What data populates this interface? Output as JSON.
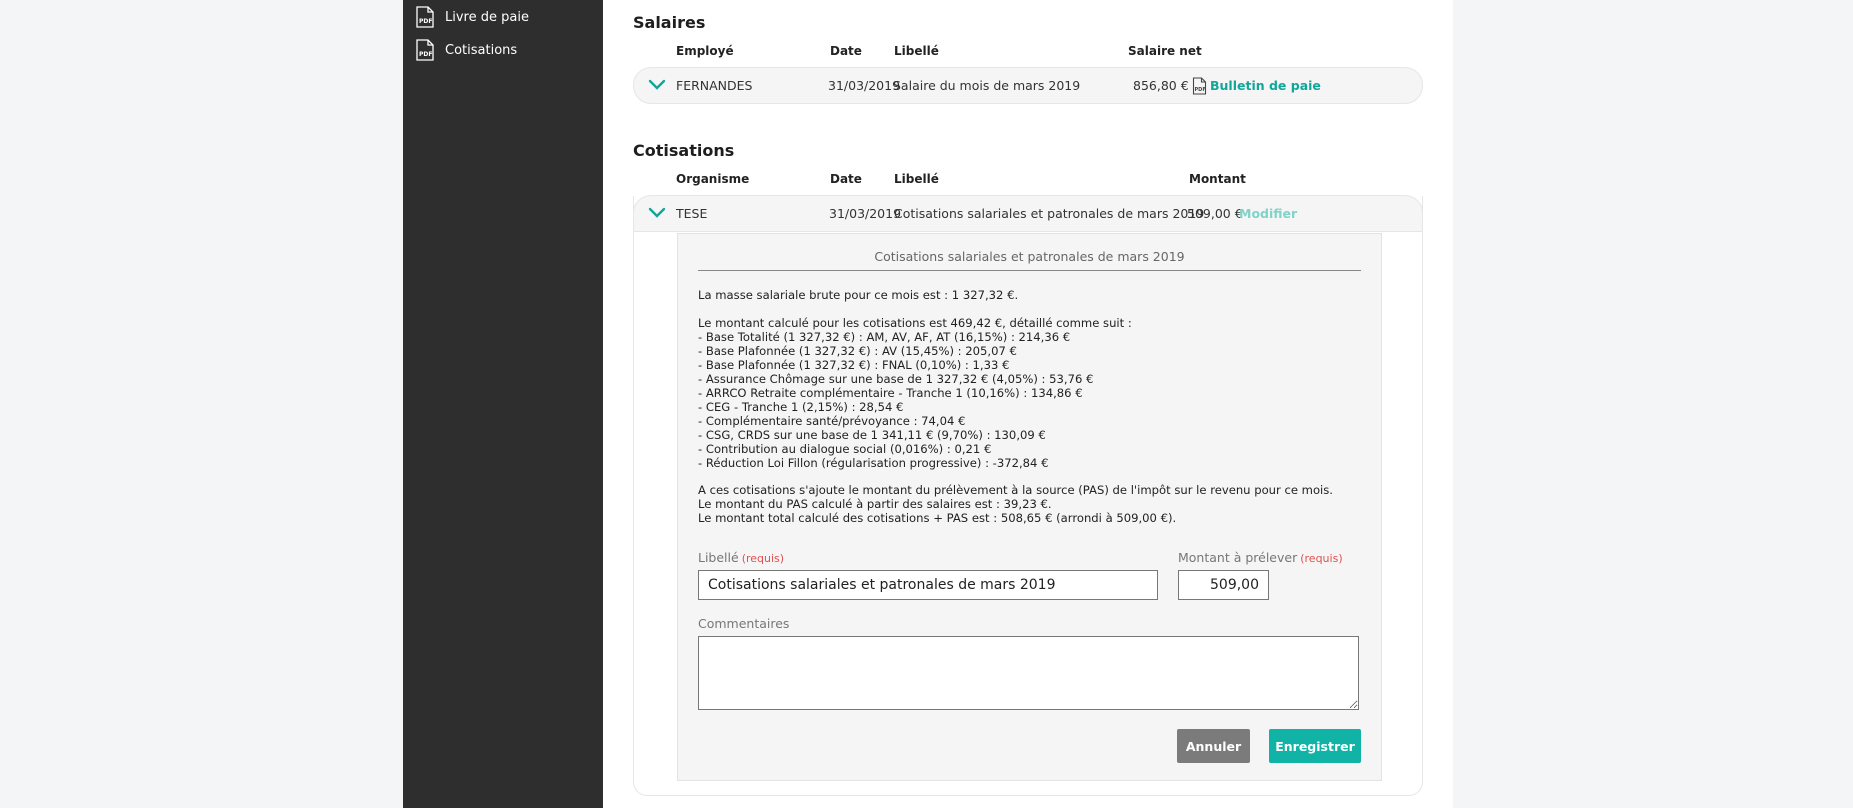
{
  "sidebar": {
    "items": [
      {
        "label": "Livre de paie"
      },
      {
        "label": "Cotisations"
      }
    ]
  },
  "salaires": {
    "title": "Salaires",
    "headers": {
      "employe": "Employé",
      "date": "Date",
      "libelle": "Libellé",
      "salaire_net": "Salaire net"
    },
    "row": {
      "employe": "FERNANDES",
      "date": "31/03/2019",
      "libelle": "Salaire du mois de mars 2019",
      "salaire_net": "856,80 €",
      "link": "Bulletin de paie"
    }
  },
  "cotisations": {
    "title": "Cotisations",
    "headers": {
      "organisme": "Organisme",
      "date": "Date",
      "libelle": "Libellé",
      "montant": "Montant"
    },
    "row": {
      "organisme": "TESE",
      "date": "31/03/2019",
      "libelle": "Cotisations salariales et patronales de mars 2019",
      "montant": "509,00 €",
      "link": "Modifier"
    }
  },
  "detail": {
    "title": "Cotisations salariales et patronales de mars 2019",
    "p1": "La masse salariale brute pour ce mois est : 1 327,32 €.",
    "p2_lines": [
      "Le montant calculé pour les cotisations est 469,42 €, détaillé comme suit :",
      "- Base Totalité (1 327,32 €) : AM, AV, AF, AT (16,15%) : 214,36 €",
      "- Base Plafonnée (1 327,32 €) : AV (15,45%) : 205,07 €",
      "- Base Plafonnée (1 327,32 €) : FNAL (0,10%) : 1,33 €",
      "- Assurance Chômage sur une base de 1 327,32 € (4,05%) : 53,76 €",
      "- ARRCO Retraite complémentaire - Tranche 1 (10,16%) : 134,86 €",
      "- CEG - Tranche 1 (2,15%) : 28,54 €",
      "- Complémentaire santé/prévoyance : 74,04 €",
      "- CSG, CRDS sur une base de 1 341,11 € (9,70%) : 130,09 €",
      "- Contribution au dialogue social (0,016%) : 0,21 €",
      "- Réduction Loi Fillon (régularisation progressive) : -372,84 €"
    ],
    "p3_lines": [
      "A ces cotisations s'ajoute le montant du prélèvement à la source (PAS) de l'impôt sur le revenu pour ce mois.",
      "Le montant du PAS calculé à partir des salaires est : 39,23 €.",
      "Le montant total calculé des cotisations + PAS est : 508,65 € (arrondi à 509,00 €)."
    ],
    "form": {
      "libelle_label": "Libellé",
      "libelle_req": "(requis)",
      "libelle_value": "Cotisations salariales et patronales de mars 2019",
      "montant_label": "Montant à prélever",
      "montant_req": "(requis)",
      "montant_value": "509,00",
      "commentaires_label": "Commentaires",
      "commentaires_value": "",
      "cancel_label": "Annuler",
      "save_label": "Enregistrer"
    }
  },
  "colors": {
    "teal": "#10a79a",
    "teal_light": "#7fd3ca",
    "sidebar": "#2e2e2e",
    "cancel": "#7b7b7b",
    "required": "#e05050"
  }
}
